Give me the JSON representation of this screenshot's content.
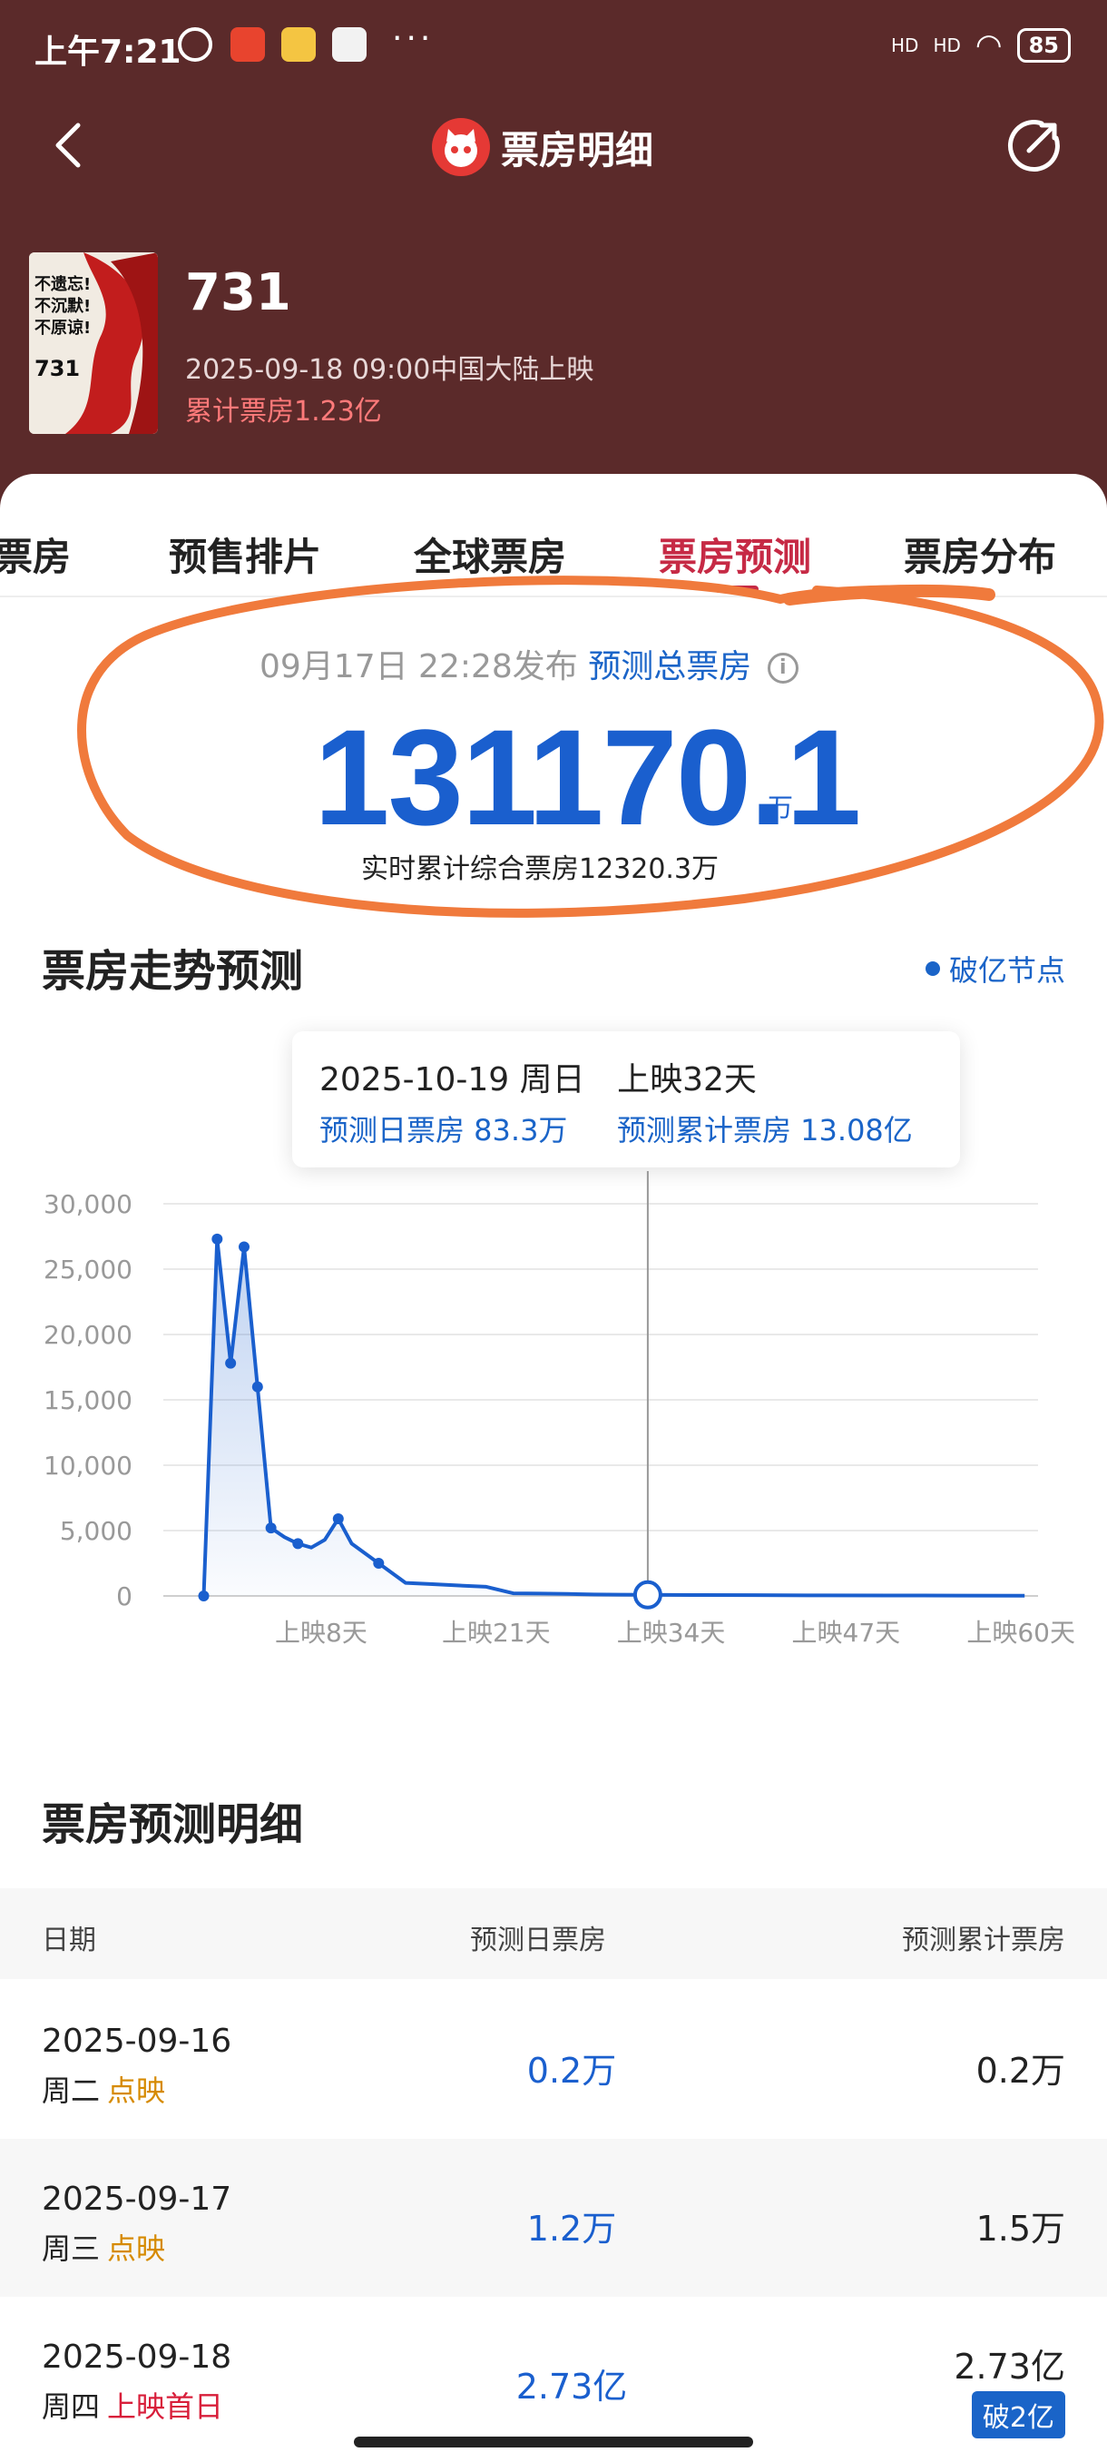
{
  "status_bar": {
    "time": "上午7:21",
    "dots": "···",
    "signal_1": "HD",
    "signal_2": "HD",
    "battery": "85"
  },
  "nav": {
    "title": "票房明细"
  },
  "movie": {
    "title": "731",
    "release": "2025-09-18 09:00中国大陆上映",
    "box_office": "累计票房1.23亿",
    "poster_lines": [
      "不遗忘!",
      "不沉默!",
      "不原谅!",
      "731"
    ]
  },
  "tabs": [
    {
      "label": "票房",
      "active": false
    },
    {
      "label": "预售排片",
      "active": false
    },
    {
      "label": "全球票房",
      "active": false
    },
    {
      "label": "票房预测",
      "active": true
    },
    {
      "label": "票房分布",
      "active": false
    }
  ],
  "forecast": {
    "published": "09月17日 22:28发布",
    "label": "预测总票房",
    "info": "i",
    "total": "131170.1",
    "unit": "万",
    "realtime": "实时累计综合票房12320.3万"
  },
  "trend": {
    "title": "票房走势预测",
    "legend": "破亿节点",
    "tooltip": {
      "date": "2025-10-19 周日",
      "days": "上映32天",
      "day_label": "预测日票房 83.3万",
      "cum_label": "预测累计票房 13.08亿"
    }
  },
  "chart_data": {
    "type": "area",
    "y_ticks": [
      "30,000",
      "25,000",
      "20,000",
      "15,000",
      "10,000",
      "5,000",
      "0"
    ],
    "x_ticks": [
      "上映8天",
      "上映21天",
      "上映34天",
      "上映47天",
      "上映60天"
    ],
    "ylim": [
      0,
      30000
    ],
    "x": [
      -1,
      0,
      1,
      2,
      3,
      4,
      5,
      6,
      7,
      8,
      9,
      10,
      12,
      14,
      16,
      18,
      20,
      22,
      24,
      26,
      28,
      30,
      32,
      36,
      40,
      45,
      50,
      55,
      60
    ],
    "values": [
      0,
      27300,
      17800,
      26700,
      16000,
      5200,
      4500,
      4000,
      3700,
      4300,
      5900,
      4000,
      2500,
      1000,
      900,
      800,
      700,
      200,
      180,
      150,
      110,
      95,
      83.3,
      70,
      60,
      45,
      35,
      28,
      20
    ],
    "marked_points": [
      0,
      1,
      2,
      3,
      4,
      5,
      7,
      10,
      12,
      22
    ],
    "highlight_x": 32,
    "grid": true
  },
  "detail": {
    "title": "票房预测明细",
    "headers": {
      "date": "日期",
      "day": "预测日票房",
      "cum": "预测累计票房"
    },
    "rows": [
      {
        "date": "2025-09-16",
        "week": "周二",
        "tag": "点映",
        "day": "0.2万",
        "cum": "0.2万"
      },
      {
        "date": "2025-09-17",
        "week": "周三",
        "tag": "点映",
        "day": "1.2万",
        "cum": "1.5万"
      },
      {
        "date": "2025-09-18",
        "week": "周四",
        "tag": "上映首日",
        "day": "2.73亿",
        "cum": "2.73亿",
        "badge": "破2亿"
      }
    ]
  },
  "colors": {
    "header_bg": "#5b2a2a",
    "accent_red": "#c62a45",
    "primary_blue": "#1a5fce",
    "annotation_orange": "#f07a3c"
  }
}
